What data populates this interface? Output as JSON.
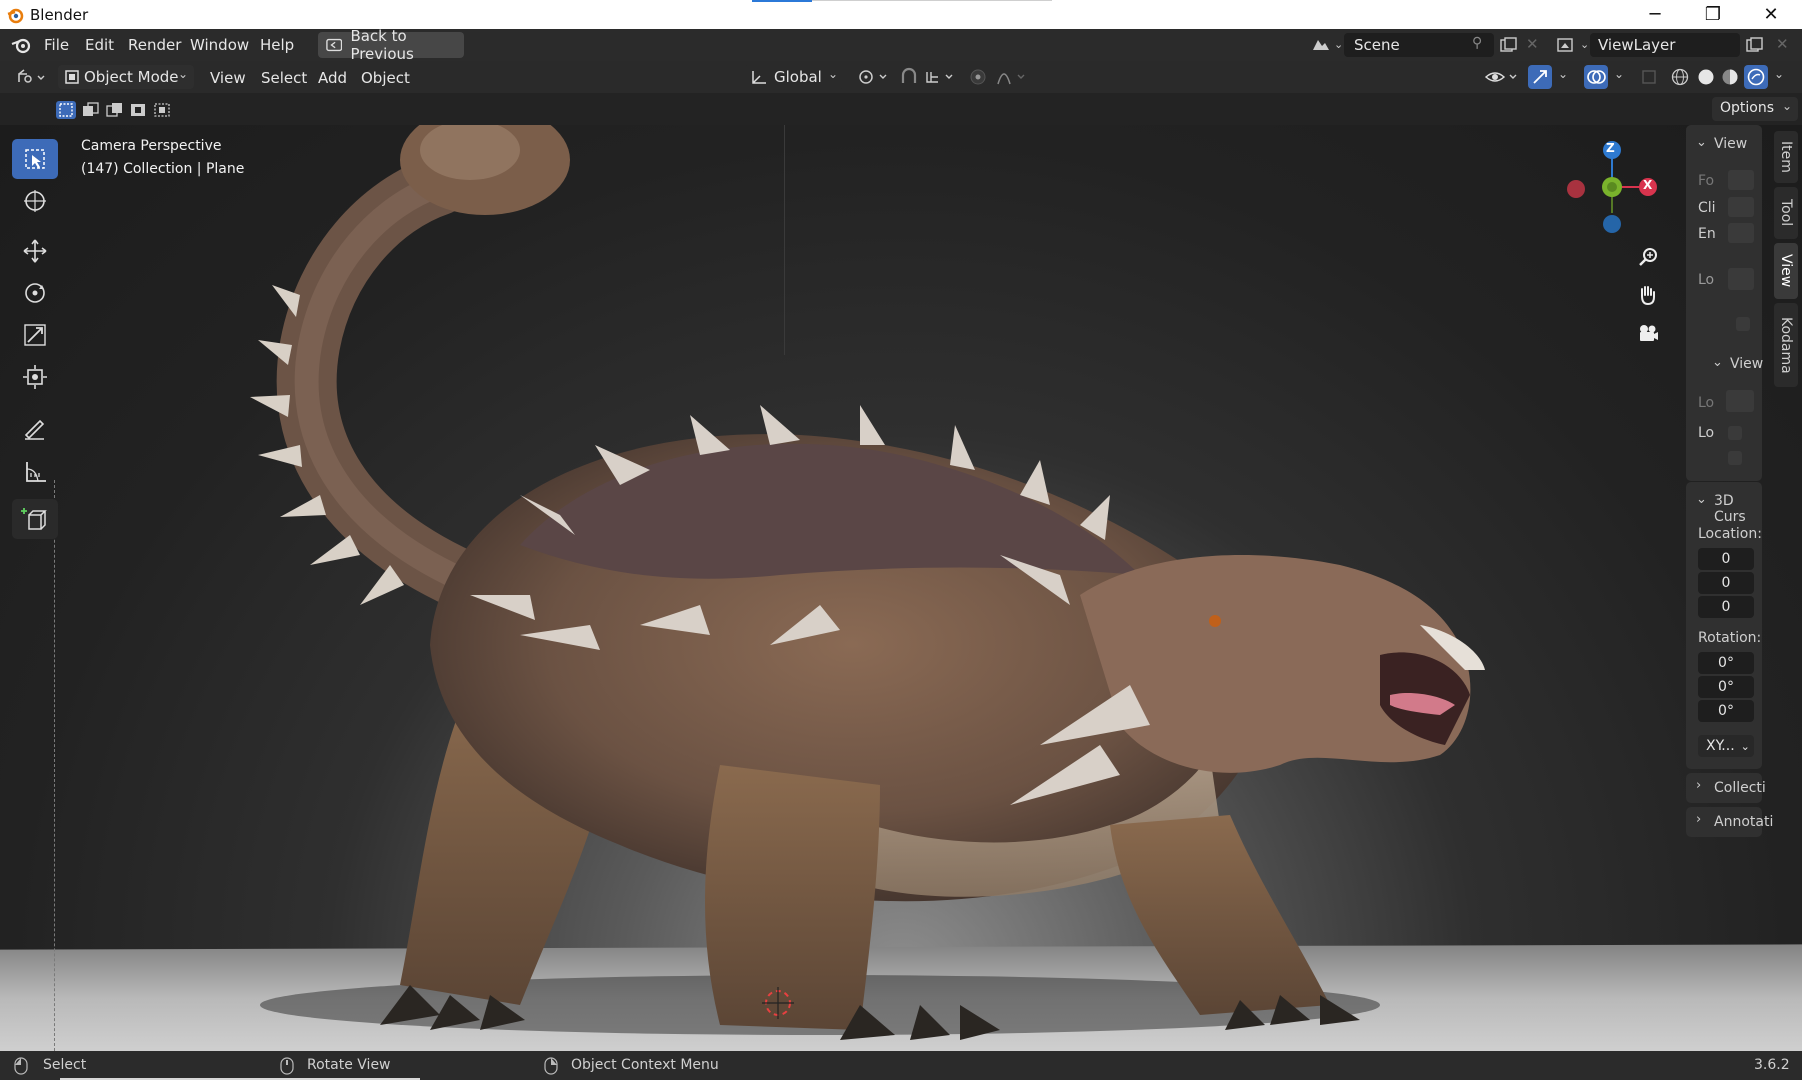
{
  "titlebar": {
    "app_title": "Blender",
    "min": "─",
    "max": "❐",
    "close": "✕"
  },
  "menu": {
    "items": [
      "File",
      "Edit",
      "Render",
      "Window",
      "Help"
    ],
    "back_label": "Back to Previous",
    "scene_value": "Scene",
    "viewlayer_value": "ViewLayer"
  },
  "header": {
    "mode": "Object Mode",
    "menus": [
      "View",
      "Select",
      "Add",
      "Object"
    ],
    "orientation": "Global"
  },
  "toolrow": {
    "options": "Options"
  },
  "viewport": {
    "camera_line1": "Camera Perspective",
    "camera_line2": "(147) Collection | Plane",
    "gizmo": {
      "z": "Z",
      "x": "X"
    }
  },
  "npanel": {
    "view_header": "View",
    "view_rows": [
      "Fo",
      "Cli",
      "En",
      "Lo"
    ],
    "view2_header": "View",
    "view2_rows": [
      "Lo",
      "Lo"
    ],
    "cursor_header": "3D Curs",
    "location_label": "Location:",
    "location": [
      "0",
      "0",
      "0"
    ],
    "rotation_label": "Rotation:",
    "rotation": [
      "0°",
      "0°",
      "0°"
    ],
    "rotation_mode": "XY...",
    "collection_header": "Collecti",
    "annotation_header": "Annotati"
  },
  "sidetabs": [
    "Item",
    "Tool",
    "View",
    "Kodama"
  ],
  "statusbar": {
    "select": "Select",
    "rotate": "Rotate View",
    "context": "Object Context Menu",
    "version": "3.6.2"
  },
  "colors": {
    "accent": "#3d6bb8",
    "x_axis": "#d8344e",
    "y_axis": "#7ab32c",
    "z_axis": "#2e7ad1"
  }
}
